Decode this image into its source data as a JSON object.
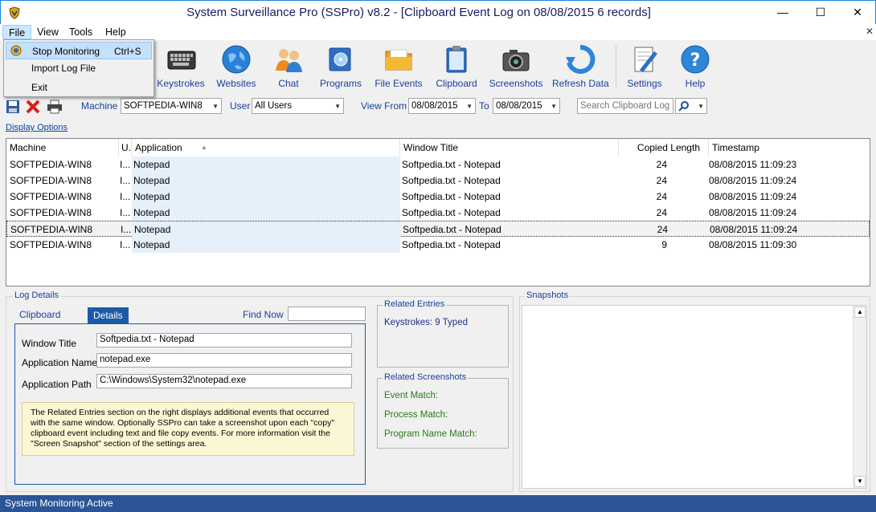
{
  "window": {
    "title": "System Surveillance Pro (SSPro) v8.2 - [Clipboard Event Log on 08/08/2015  6 records]",
    "minimize": "—",
    "maximize": "☐",
    "close": "✕"
  },
  "menu": {
    "items": [
      {
        "label": "File"
      },
      {
        "label": "View"
      },
      {
        "label": "Tools"
      },
      {
        "label": "Help"
      }
    ],
    "close_glyph": "✕",
    "file_dropdown": {
      "stop_monitoring": "Stop Monitoring",
      "stop_shortcut": "Ctrl+S",
      "import_log": "Import Log File",
      "exit": "Exit"
    }
  },
  "toolbar": {
    "buttons": [
      {
        "label": "Keystrokes",
        "icon": "keyboard-icon"
      },
      {
        "label": "Websites",
        "icon": "globe-icon"
      },
      {
        "label": "Chat",
        "icon": "chat-users-icon"
      },
      {
        "label": "Programs",
        "icon": "programs-icon"
      },
      {
        "label": "File Events",
        "icon": "folder-icon"
      },
      {
        "label": "Clipboard",
        "icon": "clipboard-icon"
      },
      {
        "label": "Screenshots",
        "icon": "camera-icon"
      },
      {
        "label": "Refresh Data",
        "icon": "refresh-icon"
      },
      {
        "label": "Settings",
        "icon": "settings-icon"
      },
      {
        "label": "Help",
        "icon": "help-icon"
      }
    ]
  },
  "filters": {
    "machine_label": "Machine",
    "machine_value": "SOFTPEDIA-WIN8",
    "user_label": "User",
    "user_value": "All Users",
    "view_from_label": "View From",
    "from_date": "08/08/2015",
    "to_label": "To",
    "to_date": "08/08/2015",
    "search_placeholder": "Search Clipboard Log"
  },
  "display_options": "Display Options",
  "grid": {
    "columns": [
      "Machine",
      "U.",
      "Application",
      "Window Title",
      "Copied Length",
      "Timestamp"
    ],
    "rows": [
      {
        "machine": "SOFTPEDIA-WIN8",
        "user": "I...",
        "application": "Notepad",
        "window_title": "Softpedia.txt - Notepad",
        "length": "24",
        "timestamp": "08/08/2015 11:09:23"
      },
      {
        "machine": "SOFTPEDIA-WIN8",
        "user": "I...",
        "application": "Notepad",
        "window_title": "Softpedia.txt - Notepad",
        "length": "24",
        "timestamp": "08/08/2015 11:09:24"
      },
      {
        "machine": "SOFTPEDIA-WIN8",
        "user": "I...",
        "application": "Notepad",
        "window_title": "Softpedia.txt - Notepad",
        "length": "24",
        "timestamp": "08/08/2015 11:09:24"
      },
      {
        "machine": "SOFTPEDIA-WIN8",
        "user": "I...",
        "application": "Notepad",
        "window_title": "Softpedia.txt - Notepad",
        "length": "24",
        "timestamp": "08/08/2015 11:09:24"
      },
      {
        "machine": "SOFTPEDIA-WIN8",
        "user": "I...",
        "application": "Notepad",
        "window_title": "Softpedia.txt - Notepad",
        "length": "24",
        "timestamp": "08/08/2015 11:09:24"
      },
      {
        "machine": "SOFTPEDIA-WIN8",
        "user": "I...",
        "application": "Notepad",
        "window_title": "Softpedia.txt - Notepad",
        "length": "9",
        "timestamp": "08/08/2015 11:09:30"
      }
    ],
    "selected_row": 4
  },
  "log_details": {
    "title": "Log Details",
    "tab_clipboard": "Clipboard Text",
    "tab_details": "Details",
    "find_now": "Find Now",
    "window_title_label": "Window Title",
    "window_title_value": "Softpedia.txt - Notepad",
    "app_name_label": "Application Name",
    "app_name_value": "notepad.exe",
    "app_path_label": "Application Path",
    "app_path_value": "C:\\Windows\\System32\\notepad.exe",
    "info": "The Related Entries section on the right displays additional events that occurred with the same window. Optionally SSPro can take a screenshot upon each \"copy\" clipboard event including text and file copy events. For more information visit the \"Screen Snapshot\" section of the settings area."
  },
  "related_entries": {
    "title": "Related Entries",
    "keystrokes": "Keystrokes: 9 Typed"
  },
  "related_screenshots": {
    "title": "Related Screenshots",
    "event_match": "Event Match:",
    "process_match": "Process Match:",
    "program_name_match": "Program Name Match:"
  },
  "snapshots": {
    "title": "Snapshots"
  },
  "status": "System Monitoring Active",
  "colors": {
    "accent": "#1c5aa7",
    "status_bar": "#2c5597",
    "link": "#1a3f9a",
    "green_text": "#2a7a1a"
  }
}
